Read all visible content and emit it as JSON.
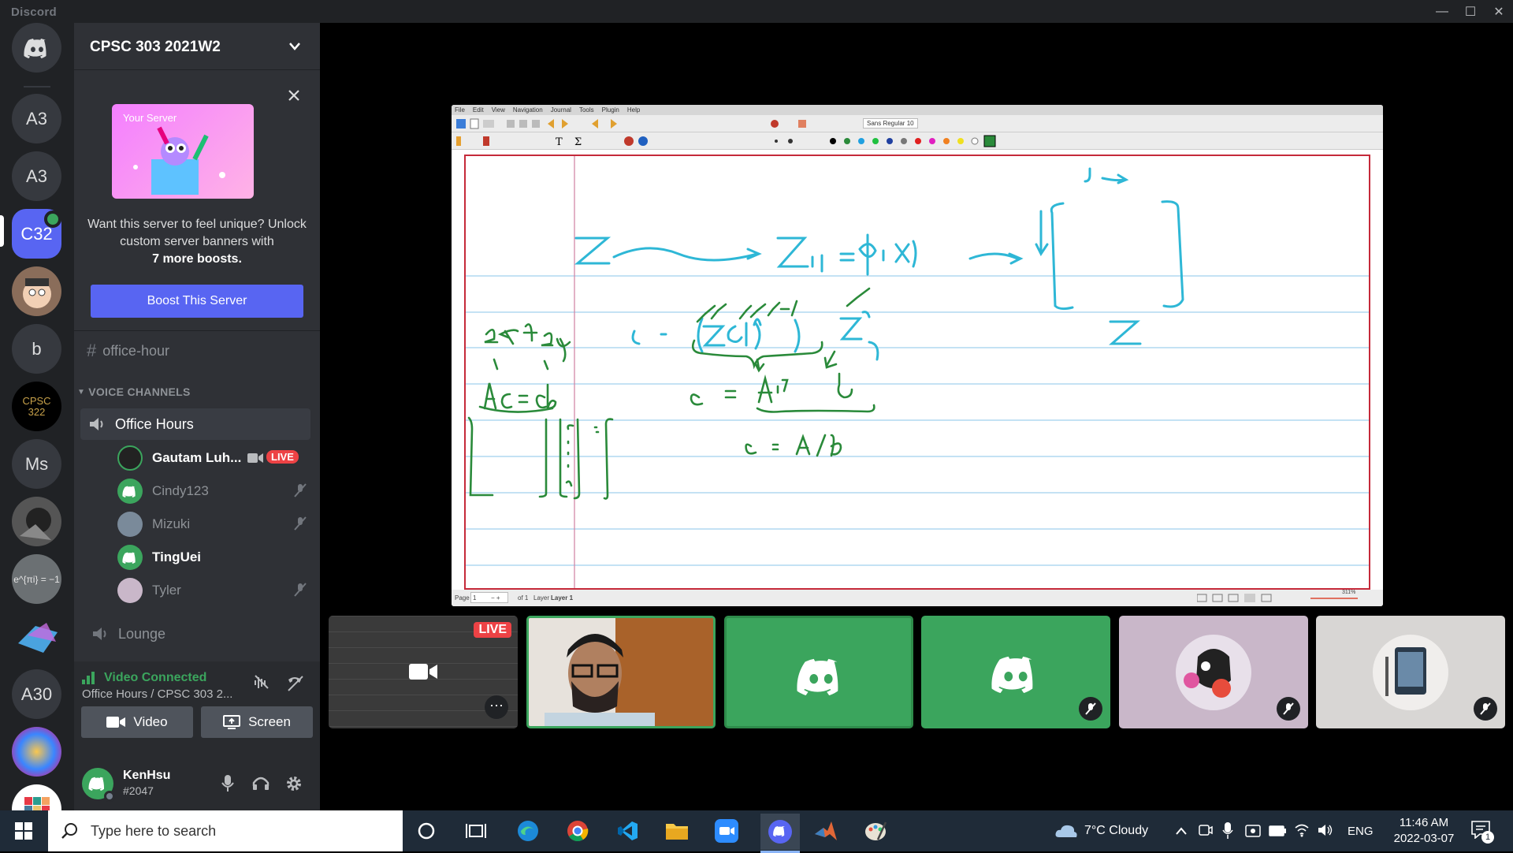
{
  "titlebar": {
    "app_name": "Discord"
  },
  "rail": {
    "items": [
      {
        "label": "A3",
        "icon": "discord-logo-icon"
      },
      {
        "label": "A3"
      },
      {
        "label": "C32"
      },
      {
        "label": "b"
      },
      {
        "label": "CPSC 322"
      },
      {
        "label": "Ms"
      },
      {
        "label": "e^{πi} = −1"
      },
      {
        "label": "A30"
      }
    ]
  },
  "server": {
    "name": "CPSC 303 2021W2",
    "banner_label": "Your Server",
    "boost_text_1": "Want this server to feel unique? Unlock custom server banners with",
    "boost_text_2": "7 more boosts.",
    "boost_button": "Boost This Server"
  },
  "channels": {
    "text_channel": "office-hour",
    "voice_header": "VOICE CHANNELS",
    "voice_channel": "Office Hours",
    "voice_users": [
      {
        "name": "Gautam Luh...",
        "live": "LIVE"
      },
      {
        "name": "Cindy123"
      },
      {
        "name": "Mizuki"
      },
      {
        "name": "TingUei"
      },
      {
        "name": "Tyler"
      }
    ],
    "lounge": "Lounge"
  },
  "voice_panel": {
    "status": "Video Connected",
    "location": "Office Hours / CPSC 303 2...",
    "video_button": "Video",
    "screen_button": "Screen"
  },
  "user_panel": {
    "username": "KenHsu",
    "tag": "#2047"
  },
  "xournal": {
    "menu": [
      "File",
      "Edit",
      "View",
      "Navigation",
      "Journal",
      "Tools",
      "Plugin",
      "Help"
    ],
    "font": "Sans Regular",
    "font_size": "10",
    "status_page_label": "Page",
    "status_page": "1",
    "status_of": "of 1",
    "status_layer_label": "Layer",
    "status_layer": "Layer 1",
    "zoom": "311%"
  },
  "stream": {
    "live": "LIVE"
  },
  "taskbar": {
    "search_placeholder": "Type here to search",
    "weather": "7°C  Cloudy",
    "language": "ENG",
    "time": "11:46 AM",
    "date": "2022-03-07",
    "notification_count": "1"
  },
  "colors": {
    "blurple": "#5865f2",
    "green": "#3ba55d",
    "live_red": "#ed4245",
    "ink_blue": "#2eb7d6",
    "ink_green": "#2a8a3a"
  }
}
